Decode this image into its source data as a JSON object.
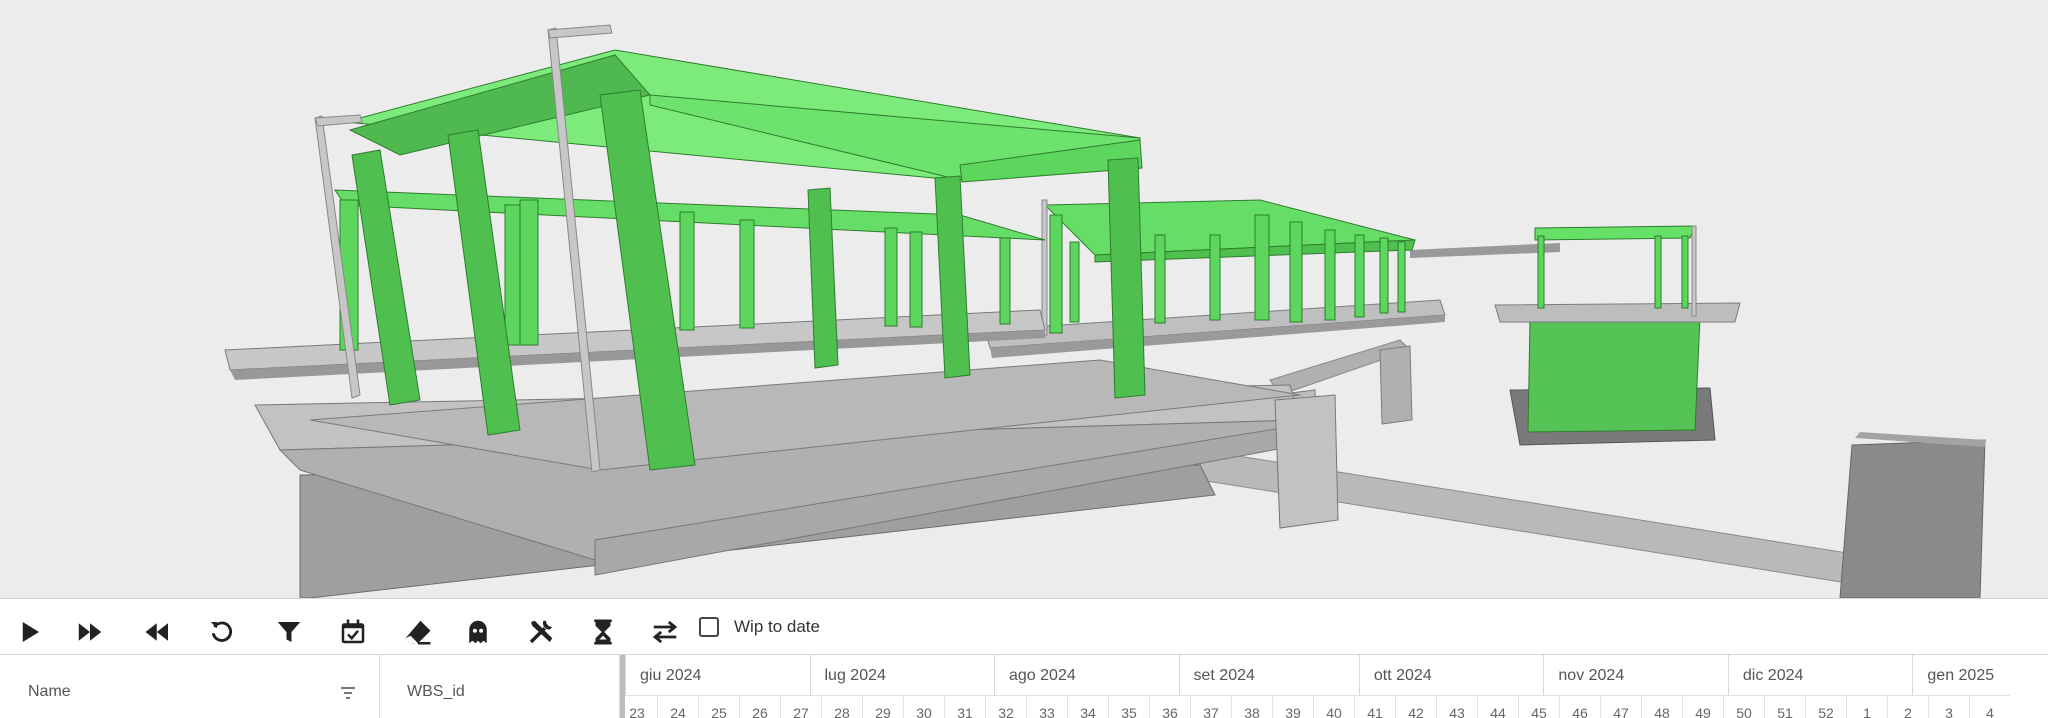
{
  "toolbar": {
    "buttons": [
      {
        "icon": "play-icon"
      },
      {
        "icon": "fast-forward-icon"
      },
      {
        "icon": "rewind-icon"
      },
      {
        "icon": "reset-icon"
      },
      {
        "icon": "filter-icon"
      },
      {
        "icon": "calendar-check-icon"
      },
      {
        "icon": "eraser-icon"
      },
      {
        "icon": "ghost-icon"
      },
      {
        "icon": "tools-icon"
      },
      {
        "icon": "hourglass-icon"
      },
      {
        "icon": "swap-icon"
      }
    ],
    "wip_label": "Wip to date",
    "wip_checked": false
  },
  "grid": {
    "columns": [
      {
        "label": "Name"
      },
      {
        "label": "WBS_id"
      }
    ]
  },
  "timeline": {
    "months": [
      "giu 2024",
      "lug 2024",
      "ago 2024",
      "set 2024",
      "ott 2024",
      "nov 2024",
      "dic 2024",
      "gen 2025"
    ],
    "weeks": [
      "23",
      "24",
      "25",
      "26",
      "27",
      "28",
      "29",
      "30",
      "31",
      "32",
      "33",
      "34",
      "35",
      "36",
      "37",
      "38",
      "39",
      "40",
      "41",
      "42",
      "43",
      "44",
      "45",
      "46",
      "47",
      "48",
      "49",
      "50",
      "51",
      "52",
      "1",
      "2",
      "3",
      "4"
    ]
  },
  "colors": {
    "structure_green": "#5cd65c",
    "concrete_gray": "#b5b5b5",
    "background": "#ececec"
  }
}
